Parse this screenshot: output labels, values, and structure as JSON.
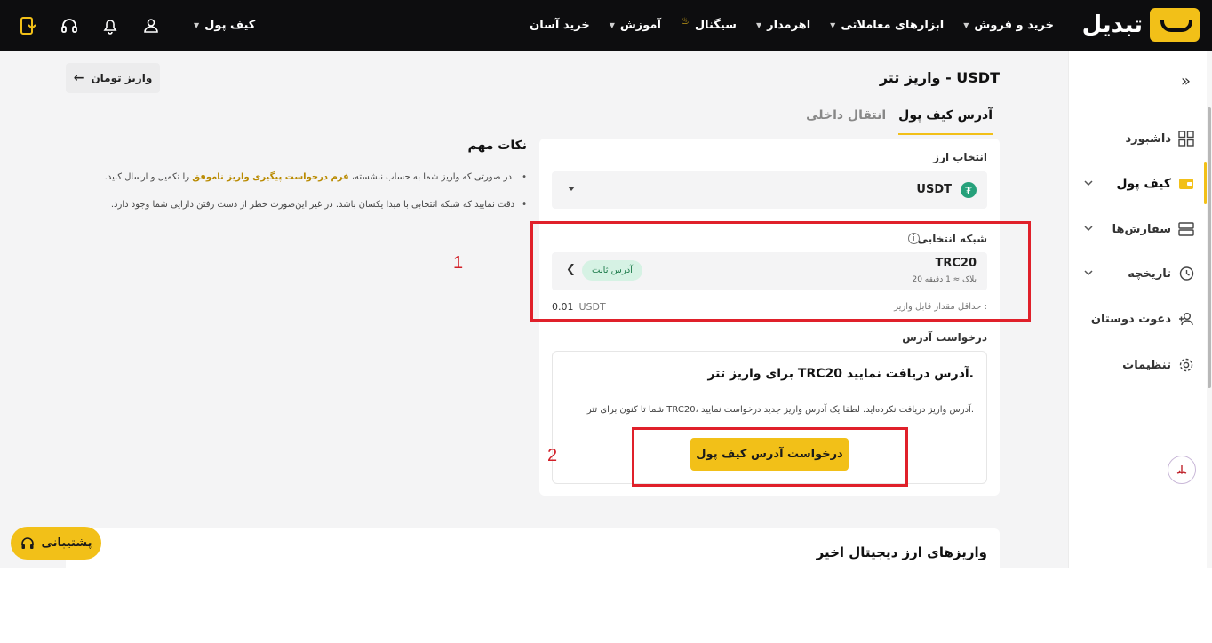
{
  "app": {
    "brand": "تبدیل"
  },
  "nav": {
    "items": [
      {
        "label": "خرید و فروش",
        "dropdown": true
      },
      {
        "label": "ابزارهای معاملاتی",
        "dropdown": true
      },
      {
        "label": "اهرمدار",
        "dropdown": true
      },
      {
        "label": "سیگنال",
        "dropdown": false
      },
      {
        "label": "آموزش",
        "dropdown": true
      },
      {
        "label": "خرید آسان",
        "dropdown": false
      }
    ],
    "wallet_label": "کیف پول"
  },
  "sidebar": {
    "items": [
      {
        "label": "داشبورد"
      },
      {
        "label": "کیف پول"
      },
      {
        "label": "سفارش‌ها"
      },
      {
        "label": "تاریخچه"
      },
      {
        "label": "دعوت دوستان"
      },
      {
        "label": "تنظیمات"
      }
    ]
  },
  "page": {
    "title": "واریز تتر - USDT",
    "back_label": "واریز تومان",
    "tabs": [
      {
        "label": "آدرس کیف پول",
        "active": true
      },
      {
        "label": "انتقال داخلی",
        "active": false
      }
    ]
  },
  "form": {
    "currency_label": "انتخاب ارز",
    "currency_value": "USDT",
    "network_label": "شبکه انتخابی",
    "network_name": "TRC20",
    "network_sub": "20 بلاک ≈ 1 دقیقه",
    "network_badge": "آدرس ثابت",
    "min_label": "حداقل مقدار قابل واریز :",
    "min_value": "0.01",
    "min_unit": "USDT",
    "request_section_label": "درخواست آدرس",
    "request_title": "برای واریز تتر TRC20 آدرس دریافت نمایید.",
    "request_desc": "شما تا کنون برای تتر TRC20، آدرس واریز دریافت نکرده‌اید. لطفا یک آدرس واریز جدید درخواست نمایید.",
    "request_button": "درخواست آدرس کیف پول"
  },
  "notes": {
    "title": "نکات مهم",
    "note1_pre": "در صورتی که واریز شما به حساب ننشسته،",
    "note1_link": "فرم درخواست پیگیری واریز ناموفق",
    "note1_post": "را تکمیل و ارسال کنید.",
    "note2": "دقت نمایید که شبکه انتخابی با مبدا یکسان باشد. در غیر این‌صورت خطر از دست رفتن دارایی شما وجود دارد."
  },
  "annotations": {
    "label1": "1",
    "label2": "2",
    "color": "#e0202a"
  },
  "recent": {
    "title": "واریزهای ارز دیجیتال اخیر"
  },
  "support": {
    "label": "پشتیبانی"
  },
  "colors": {
    "accent": "#f2c018",
    "topbar": "#0d0d0f",
    "tether": "#26a17b"
  }
}
